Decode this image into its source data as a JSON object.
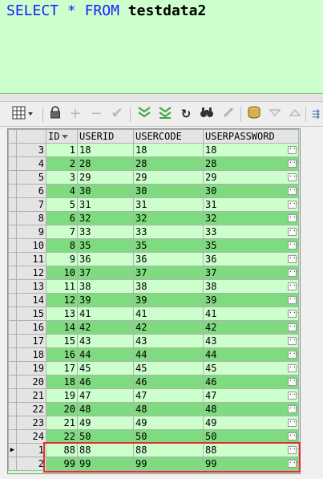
{
  "editor": {
    "kw_select": "SELECT",
    "star": "*",
    "kw_from": "FROM",
    "table_name": "testdata2"
  },
  "toolbar": {
    "icons": [
      "grid-view-icon",
      "lock-icon",
      "add-row-icon",
      "delete-row-icon",
      "post-edit-icon",
      "filter-icon",
      "filter-clear-icon",
      "refresh-icon",
      "find-icon",
      "clear-icon",
      "export-icon",
      "move-down-icon",
      "move-up-icon",
      "more-icon"
    ]
  },
  "grid": {
    "columns": [
      "ID",
      "USERID",
      "USERCODE",
      "USERPASSWORD"
    ],
    "rows": [
      {
        "rownum": "3",
        "id": "1",
        "userid": "18",
        "usercode": "18",
        "userpassword": "18"
      },
      {
        "rownum": "4",
        "id": "2",
        "userid": "28",
        "usercode": "28",
        "userpassword": "28"
      },
      {
        "rownum": "5",
        "id": "3",
        "userid": "29",
        "usercode": "29",
        "userpassword": "29"
      },
      {
        "rownum": "6",
        "id": "4",
        "userid": "30",
        "usercode": "30",
        "userpassword": "30"
      },
      {
        "rownum": "7",
        "id": "5",
        "userid": "31",
        "usercode": "31",
        "userpassword": "31"
      },
      {
        "rownum": "8",
        "id": "6",
        "userid": "32",
        "usercode": "32",
        "userpassword": "32"
      },
      {
        "rownum": "9",
        "id": "7",
        "userid": "33",
        "usercode": "33",
        "userpassword": "33"
      },
      {
        "rownum": "10",
        "id": "8",
        "userid": "35",
        "usercode": "35",
        "userpassword": "35"
      },
      {
        "rownum": "11",
        "id": "9",
        "userid": "36",
        "usercode": "36",
        "userpassword": "36"
      },
      {
        "rownum": "12",
        "id": "10",
        "userid": "37",
        "usercode": "37",
        "userpassword": "37"
      },
      {
        "rownum": "13",
        "id": "11",
        "userid": "38",
        "usercode": "38",
        "userpassword": "38"
      },
      {
        "rownum": "14",
        "id": "12",
        "userid": "39",
        "usercode": "39",
        "userpassword": "39"
      },
      {
        "rownum": "15",
        "id": "13",
        "userid": "41",
        "usercode": "41",
        "userpassword": "41"
      },
      {
        "rownum": "16",
        "id": "14",
        "userid": "42",
        "usercode": "42",
        "userpassword": "42"
      },
      {
        "rownum": "17",
        "id": "15",
        "userid": "43",
        "usercode": "43",
        "userpassword": "43"
      },
      {
        "rownum": "18",
        "id": "16",
        "userid": "44",
        "usercode": "44",
        "userpassword": "44"
      },
      {
        "rownum": "19",
        "id": "17",
        "userid": "45",
        "usercode": "45",
        "userpassword": "45"
      },
      {
        "rownum": "20",
        "id": "18",
        "userid": "46",
        "usercode": "46",
        "userpassword": "46"
      },
      {
        "rownum": "21",
        "id": "19",
        "userid": "47",
        "usercode": "47",
        "userpassword": "47"
      },
      {
        "rownum": "22",
        "id": "20",
        "userid": "48",
        "usercode": "48",
        "userpassword": "48"
      },
      {
        "rownum": "23",
        "id": "21",
        "userid": "49",
        "usercode": "49",
        "userpassword": "49"
      },
      {
        "rownum": "24",
        "id": "22",
        "userid": "50",
        "usercode": "50",
        "userpassword": "50"
      },
      {
        "rownum": "1",
        "id": "88",
        "userid": "88",
        "usercode": "88",
        "userpassword": "88",
        "current": true
      },
      {
        "rownum": "2",
        "id": "99",
        "userid": "99",
        "usercode": "99",
        "userpassword": "99"
      }
    ]
  },
  "colors": {
    "editor_bg": "#ccffcc",
    "row_light": "#ccffcc",
    "row_dark": "#7fdb7f",
    "highlight": "#e03030",
    "keyword": "#1a1aff"
  }
}
